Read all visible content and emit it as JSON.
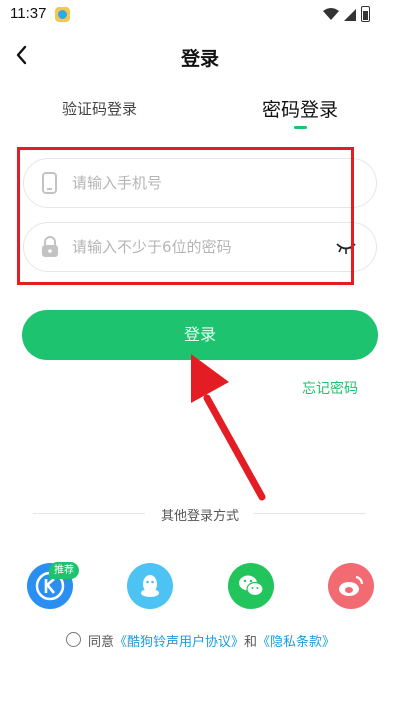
{
  "status_bar": {
    "time": "11:37"
  },
  "header": {
    "title": "登录"
  },
  "tabs": {
    "code_login": "验证码登录",
    "password_login": "密码登录"
  },
  "form": {
    "phone_placeholder": "请输入手机号",
    "password_placeholder": "请输入不少于6位的密码"
  },
  "login_button": "登录",
  "forgot_password": "忘记密码",
  "other_login": {
    "label": "其他登录方式",
    "badge": "推荐",
    "providers": [
      "kugou-icon",
      "qq-icon",
      "wechat-icon",
      "weibo-icon"
    ]
  },
  "agreement": {
    "prefix": "同意",
    "user_agreement": "《酷狗铃声用户协议》",
    "and": "和",
    "privacy": "《隐私条款》"
  },
  "colors": {
    "accent": "#1ec370",
    "highlight": "#e41d24",
    "link": "#1a9de0"
  }
}
